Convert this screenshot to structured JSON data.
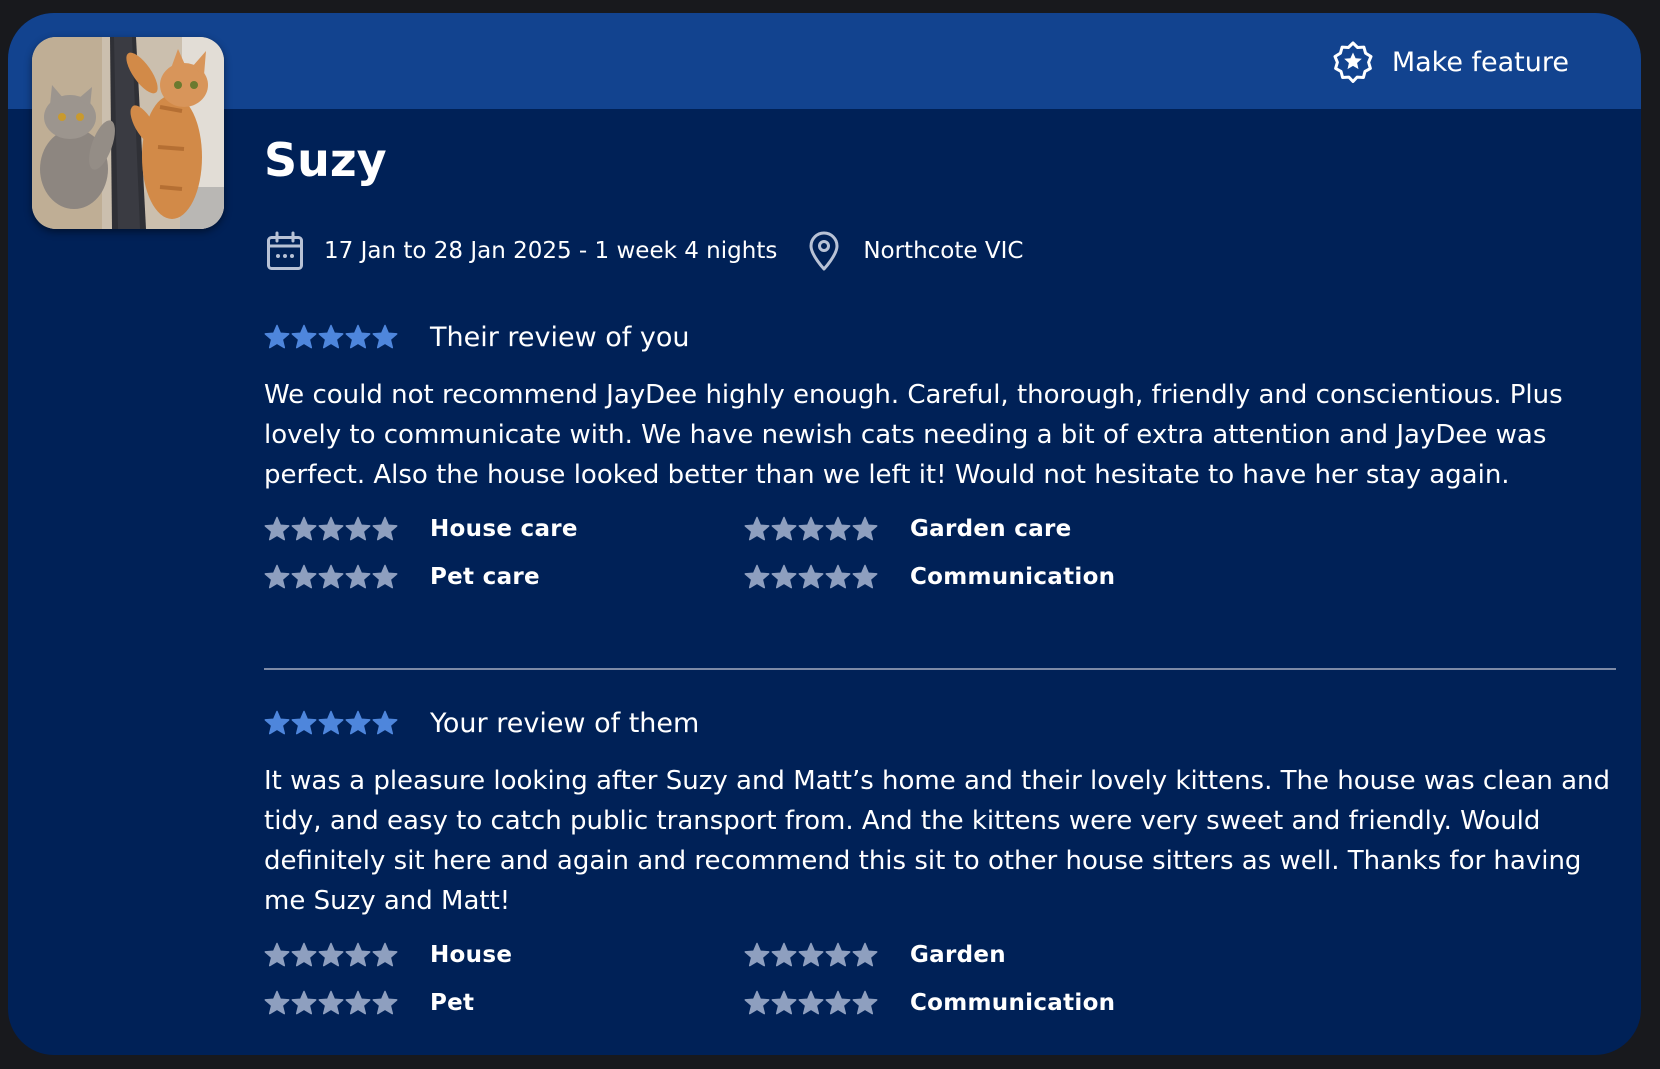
{
  "header": {
    "feature_label": "Make feature"
  },
  "listing": {
    "name": "Suzy",
    "dates": "17 Jan to 28 Jan 2025 - 1 week 4 nights",
    "location": "Northcote VIC"
  },
  "their_review": {
    "rating": 5,
    "heading": "Their review of you",
    "text": "We could not recommend JayDee highly enough. Careful, thorough, friendly and conscientious. Plus lovely to communicate with. We have newish cats needing a bit of extra attention and JayDee was perfect. Also the house looked better than we left it! Would not hesitate to have her stay again.",
    "categories": [
      {
        "label": "House care",
        "rating": 5
      },
      {
        "label": "Garden care",
        "rating": 5
      },
      {
        "label": "Pet care",
        "rating": 5
      },
      {
        "label": "Communication",
        "rating": 5
      }
    ]
  },
  "your_review": {
    "rating": 5,
    "heading": "Your review of them",
    "text": "It was a pleasure looking after Suzy and Matt’s home and their lovely kittens. The house was clean and tidy, and easy to catch public transport from. And the kittens were very sweet and friendly. Would definitely sit here and again and recommend this sit to other house sitters as well. Thanks for having me Suzy and Matt!",
    "categories": [
      {
        "label": "House",
        "rating": 5
      },
      {
        "label": "Garden",
        "rating": 5
      },
      {
        "label": "Pet",
        "rating": 5
      },
      {
        "label": "Communication",
        "rating": 5
      }
    ]
  },
  "colors": {
    "card_bg": "#002157",
    "header_bg": "#12438f",
    "star_overall": "#4e86dc",
    "star_category": "#8e9fbf",
    "text": "#ffffff"
  },
  "icons": {
    "feature": "badge-star-icon",
    "dates": "calendar-icon",
    "location": "map-pin-icon",
    "rating": "star-icon"
  }
}
